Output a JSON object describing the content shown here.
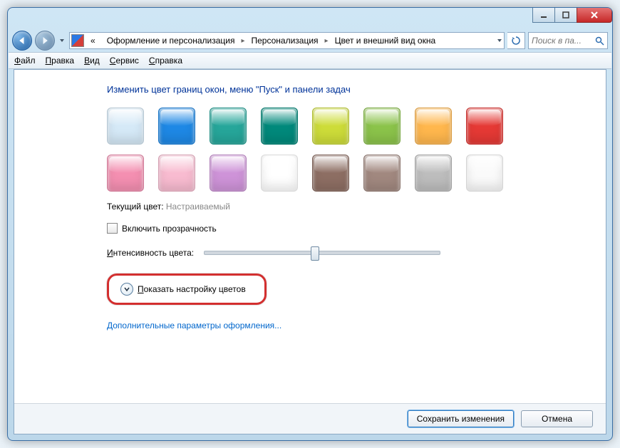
{
  "window": {
    "controls": {
      "min": "min",
      "max": "max",
      "close": "close"
    }
  },
  "address": {
    "prefix": "«",
    "crumbs": [
      "Оформление и персонализация",
      "Персонализация",
      "Цвет и внешний вид окна"
    ]
  },
  "search": {
    "placeholder": "Поиск в па..."
  },
  "menu": {
    "file": {
      "accel": "Ф",
      "rest": "айл"
    },
    "edit": {
      "accel": "П",
      "rest": "равка"
    },
    "view": {
      "accel": "В",
      "rest": "ид"
    },
    "tools": {
      "accel": "С",
      "rest": "ервис"
    },
    "help": {
      "accel": "С",
      "rest": "правка"
    }
  },
  "main": {
    "title": "Изменить цвет границ окон, меню \"Пуск\" и панели задач",
    "colors": {
      "row1": [
        "#d5e9f7",
        "#1e88e5",
        "#26a69a",
        "#00897b",
        "#cddc39",
        "#8bc34a",
        "#ffb74d",
        "#e53935"
      ],
      "row2": [
        "#f48fb1",
        "#f8bbd0",
        "#ce93d8",
        "#ffffff",
        "#8d6e63",
        "#a1887f",
        "#bdbdbd",
        "#fafafa"
      ]
    },
    "current_label": "Текущий цвет:",
    "current_value": "Настраиваемый",
    "transparency_label": "Включить прозрачность",
    "intensity_accel": "И",
    "intensity_rest": "нтенсивность цвета:",
    "intensity_value": 45,
    "expander_accel": "П",
    "expander_rest": "оказать настройку цветов",
    "advanced_link": "Дополнительные параметры оформления..."
  },
  "footer": {
    "save": "Сохранить изменения",
    "cancel": "Отмена"
  }
}
